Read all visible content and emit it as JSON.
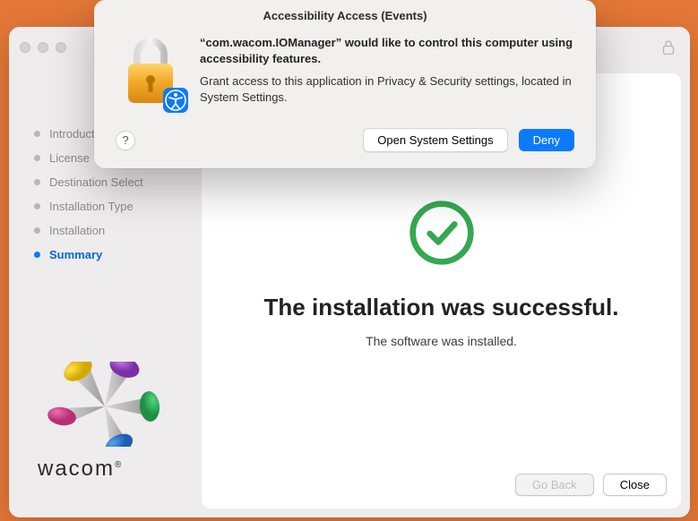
{
  "modal": {
    "title": "Accessibility Access (Events)",
    "heading": "“com.wacom.IOManager” would like to control this computer using accessibility features.",
    "description": "Grant access to this application in Privacy & Security settings, located in System Settings.",
    "open_settings_label": "Open System Settings",
    "deny_label": "Deny",
    "help_label": "?"
  },
  "sidebar": {
    "steps": [
      {
        "label": "Introduction",
        "active": false
      },
      {
        "label": "License",
        "active": false
      },
      {
        "label": "Destination Select",
        "active": false
      },
      {
        "label": "Installation Type",
        "active": false
      },
      {
        "label": "Installation",
        "active": false
      },
      {
        "label": "Summary",
        "active": true
      }
    ],
    "logo_text": "wacom"
  },
  "main": {
    "success_title": "The installation was successful.",
    "success_subtitle": "The software was installed."
  },
  "footer": {
    "go_back_label": "Go Back",
    "close_label": "Close"
  }
}
